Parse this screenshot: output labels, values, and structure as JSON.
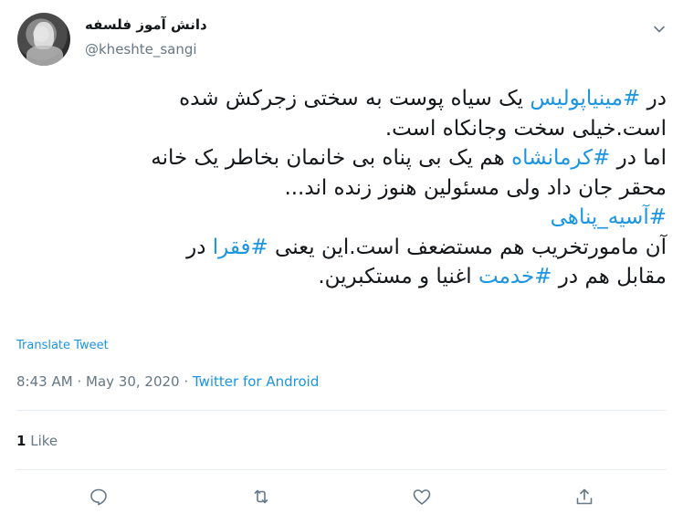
{
  "user": {
    "display_name": "دانش آموز فلسفه",
    "handle": "@kheshte_sangi"
  },
  "tweet": {
    "lines": [
      [
        {
          "t": "در "
        },
        {
          "t": "#مینیاپولیس",
          "tag": true
        },
        {
          "t": " یک سیاه پوست به سختی زجرکش شده"
        }
      ],
      [
        {
          "t": "است.خیلی سخت وجانکاه است."
        }
      ],
      [
        {
          "t": "اما در "
        },
        {
          "t": "#کرمانشاه",
          "tag": true
        },
        {
          "t": " هم یک بی پناه بی خانمان بخاطر یک خانه"
        }
      ],
      [
        {
          "t": "محقر جان داد ولی مسئولین هنوز زنده اند..."
        }
      ],
      [
        {
          "t": "#آسیه_پناهی",
          "tag": true
        }
      ],
      [
        {
          "t": "آن مامورتخریب هم مستضعف است.این یعنی "
        },
        {
          "t": "#فقرا",
          "tag": true
        },
        {
          "t": " در"
        }
      ],
      [
        {
          "t": "مقابل هم در "
        },
        {
          "t": "#خدمت",
          "tag": true
        },
        {
          "t": " اغنیا و مستکبرین."
        }
      ]
    ]
  },
  "translate_label": "Translate Tweet",
  "meta": {
    "time": "8:43 AM",
    "separator": "·",
    "date": "May 30, 2020",
    "separator2": "·",
    "source": "Twitter for Android"
  },
  "stats": {
    "likes_count": "1",
    "likes_label": "Like"
  },
  "actions": [
    "reply-icon",
    "retweet-icon",
    "like-icon",
    "share-icon"
  ],
  "colors": {
    "link": "#1b95e0",
    "muted": "#657786",
    "text": "#14171a",
    "divider": "#e6ecf0"
  }
}
